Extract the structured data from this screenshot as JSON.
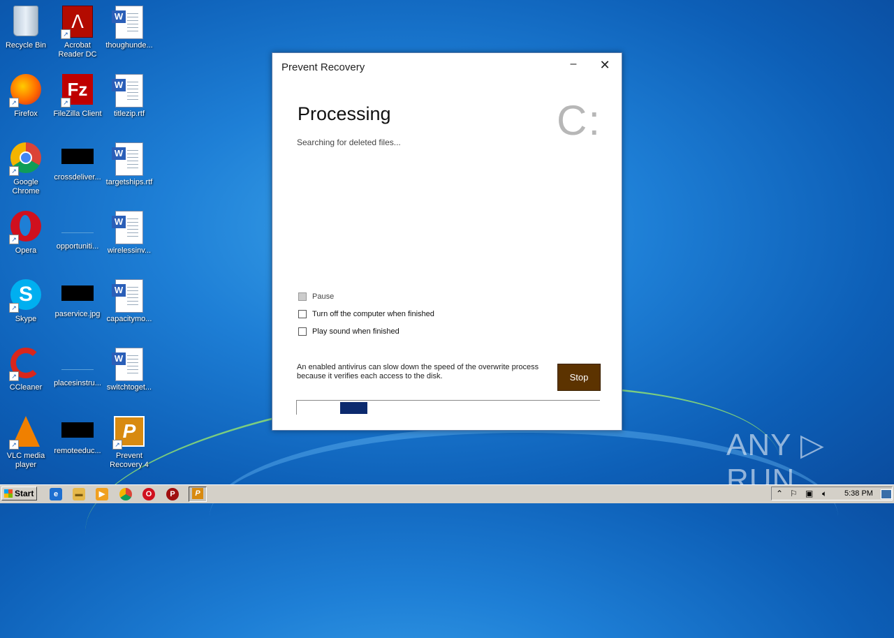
{
  "desktop": {
    "icons": [
      {
        "label": "Recycle Bin"
      },
      {
        "label": "Acrobat Reader DC"
      },
      {
        "label": "thoughunde..."
      },
      {
        "label": "Firefox"
      },
      {
        "label": "FileZilla Client"
      },
      {
        "label": "titlezip.rtf"
      },
      {
        "label": "Google Chrome"
      },
      {
        "label": "crossdeliver..."
      },
      {
        "label": "targetships.rtf"
      },
      {
        "label": "Opera"
      },
      {
        "label": "opportuniti..."
      },
      {
        "label": "wirelessinv..."
      },
      {
        "label": "Skype"
      },
      {
        "label": "paservice.jpg"
      },
      {
        "label": "capacitymo..."
      },
      {
        "label": "CCleaner"
      },
      {
        "label": "placesinstru..."
      },
      {
        "label": "switchtoget..."
      },
      {
        "label": "VLC media player"
      },
      {
        "label": "remoteeduc..."
      },
      {
        "label": "Prevent Recovery 4"
      }
    ]
  },
  "dialog": {
    "title": "Prevent Recovery",
    "minimize": "–",
    "close": "✕",
    "heading": "Processing",
    "drive": "C:",
    "status": "Searching for deleted files...",
    "options": [
      {
        "label": "Pause",
        "checked": false,
        "enabled": false
      },
      {
        "label": "Turn off the computer when finished",
        "checked": false,
        "enabled": true
      },
      {
        "label": "Play sound when finished",
        "checked": false,
        "enabled": true
      }
    ],
    "note": "An enabled antivirus can slow down the speed of the overwrite process because it verifies each access to the disk.",
    "stop_label": "Stop",
    "colors": {
      "stop_button": "#5c3300",
      "progress": "#0c2a6e",
      "drive_letter": "#b7b7b7"
    }
  },
  "watermark": "ANY ▷ RUN",
  "taskbar": {
    "start_label": "Start",
    "pinned": [
      {
        "icon": "ie-icon"
      },
      {
        "icon": "explorer-icon"
      },
      {
        "icon": "media-player-icon"
      },
      {
        "icon": "chrome-icon"
      },
      {
        "icon": "opera-icon"
      },
      {
        "icon": "prevent-recovery-icon"
      },
      {
        "icon": "prevent-recovery-active-icon"
      }
    ],
    "clock": "5:38 PM"
  }
}
